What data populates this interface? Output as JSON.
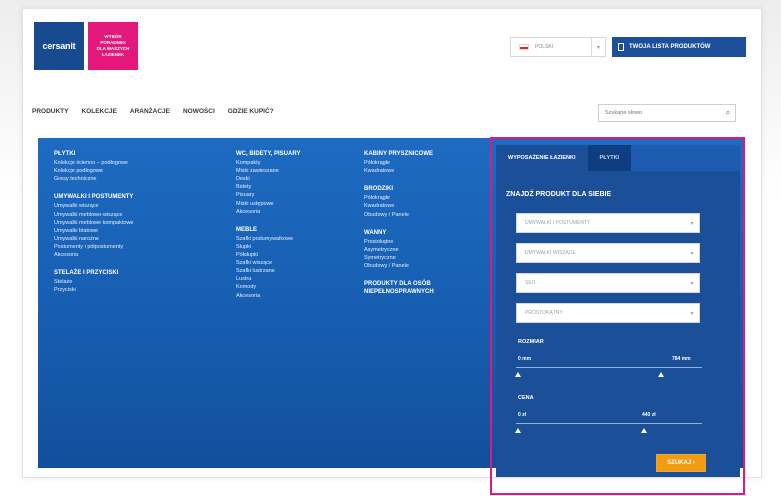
{
  "header": {
    "logo_text": "cersanit",
    "promo_lines": [
      "WYBÓR",
      "PORADNIKI",
      "DLA WASZYCH",
      "ŁAZIENEK"
    ],
    "language_label": "POLSKI",
    "product_list_button": "TWOJA LISTA PRODUKTÓW"
  },
  "nav": {
    "items": [
      "PRODUKTY",
      "KOLEKCJE",
      "ARANŻACJE",
      "NOWOŚCI",
      "GDZIE KUPIĆ?"
    ],
    "search_placeholder": "Szukane słowo"
  },
  "menu": {
    "columns": [
      [
        {
          "title": "PŁYTKI",
          "items": [
            "Kolekcje ścienno – podłogowe",
            "Kolekcje podłogowe",
            "Gresy techniczne"
          ]
        },
        {
          "title": "UMYWALKI I POSTUMENTY",
          "items": [
            "Umywalki wiszące",
            "Umywalki meblowo-wiszące",
            "Umywalki meblowe kompaktowe",
            "Umywalki blatowe",
            "Umywalki narożne",
            "Postumenty i półpostumenty",
            "Akcesoria"
          ]
        },
        {
          "title": "STELAŻE I PRZYCISKI",
          "items": [
            "Stelaże",
            "Przyciski"
          ]
        }
      ],
      [
        {
          "title": "WC, BIDETY, PISUARY",
          "items": [
            "Kompakty",
            "Miski zawieszane",
            "Deski",
            "Bidety",
            "Pisuary",
            "Miski ustępowe",
            "Akcesoria"
          ]
        },
        {
          "title": "MEBLE",
          "items": [
            "Szafki podumywalkowe",
            "Słupki",
            "Półsłupki",
            "Szafki wiszące",
            "Szafki lustrzane",
            "Lustra",
            "Komody",
            "Akcesoria"
          ]
        }
      ],
      [
        {
          "title": "KABINY PRYSZNICOWE",
          "items": [
            "Półokrągłe",
            "Kwadratowe"
          ]
        },
        {
          "title": "BRODZIKI",
          "items": [
            "Półokrągłe",
            "Kwadratowe",
            "Obudowy / Panele"
          ]
        },
        {
          "title": "WANNY",
          "items": [
            "Prostokątne",
            "Asymetryczne",
            "Symetryczne",
            "Obudowy / Panele"
          ]
        },
        {
          "title": "PRODUKTY DLA OSÓB NIEPEŁNOSPRAWNYCH",
          "items": []
        }
      ]
    ]
  },
  "finder": {
    "tabs": [
      "WYPOSAŻENIE ŁAZIENKI",
      "PŁYTKI"
    ],
    "title": "ZNAJDŹ PRODUKT DLA SIEBIE",
    "selects": [
      "UMYWALKI I POSTUMENTY",
      "UMYWALKI WISZĄCE",
      "SEO",
      "PROSTOKĄTNY"
    ],
    "size_label": "ROZMIAR",
    "size_min": "0 mm",
    "size_max": "784 mm",
    "price_label": "CENA",
    "price_min": "0 zł",
    "price_max": "440 zł",
    "search_button": "SZUKAJ ›"
  }
}
